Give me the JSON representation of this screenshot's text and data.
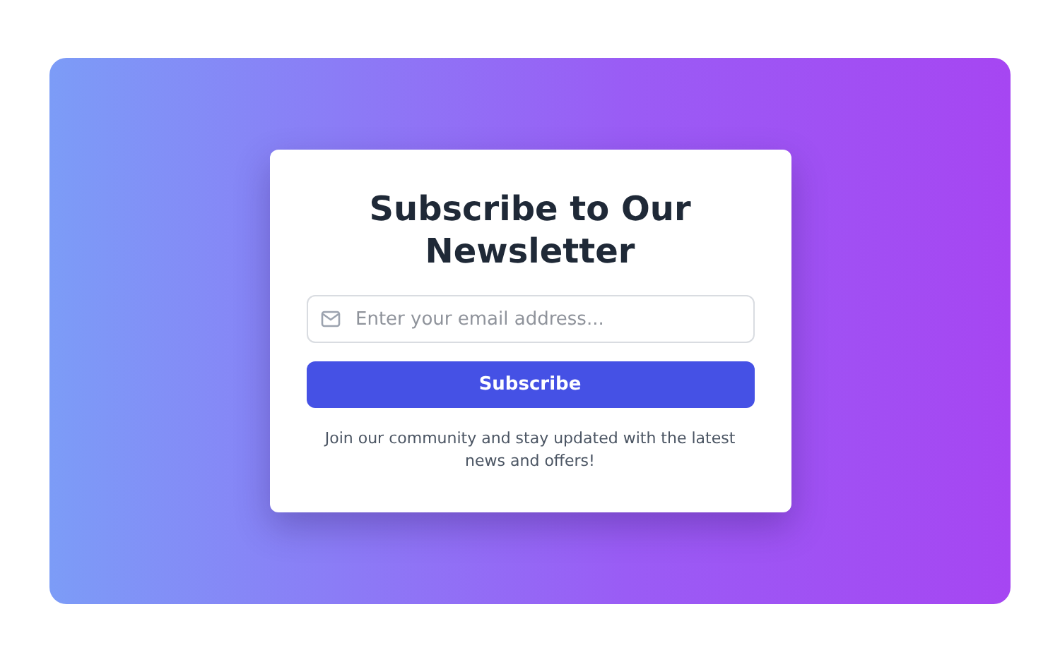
{
  "card": {
    "title": "Subscribe to Our Newsletter",
    "email_field": {
      "placeholder": "Enter your email address..."
    },
    "button": "Subscribe",
    "note": "Join our community and stay updated with the latest news and offers!"
  }
}
